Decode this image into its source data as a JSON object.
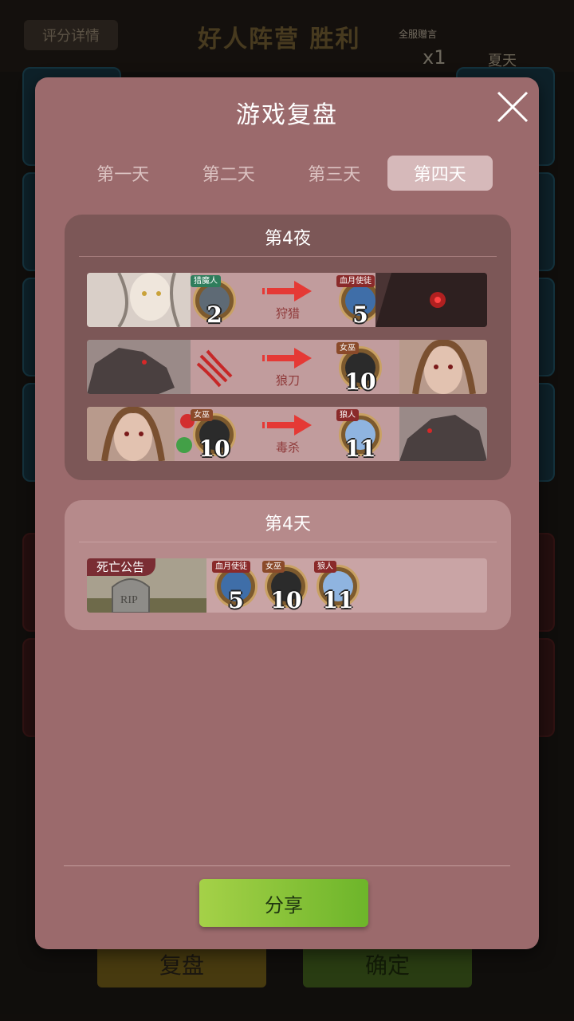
{
  "background": {
    "rating_details_label": "评分详情",
    "result_title": "好人阵营 胜利",
    "broadcast_label": "全服赠言",
    "gift_count": "x1",
    "player_name": "夏天",
    "replay_button": "复盘",
    "confirm_button": "确定"
  },
  "modal": {
    "title": "游戏复盘",
    "tabs": [
      {
        "label": "第一天",
        "active": false
      },
      {
        "label": "第二天",
        "active": false
      },
      {
        "label": "第三天",
        "active": false
      },
      {
        "label": "第四天",
        "active": true
      }
    ],
    "night": {
      "title": "第4夜",
      "events": [
        {
          "actor_role": "猎魔人",
          "actor_number": "2",
          "action": "狩猎",
          "target_role": "血月使徒",
          "target_number": "5"
        },
        {
          "actor_role": "",
          "actor_number": "",
          "action": "狼刀",
          "target_role": "女巫",
          "target_number": "10"
        },
        {
          "actor_role": "女巫",
          "actor_number": "10",
          "action": "毒杀",
          "target_role": "狼人",
          "target_number": "11"
        }
      ]
    },
    "day": {
      "title": "第4天",
      "death_label": "死亡公告",
      "deaths": [
        {
          "role": "血月使徒",
          "number": "5"
        },
        {
          "role": "女巫",
          "number": "10"
        },
        {
          "role": "狼人",
          "number": "11"
        }
      ]
    },
    "share_button": "分享"
  },
  "colors": {
    "modal_bg": "#9b6a6c",
    "tab_active_bg": "#d6b9ba",
    "share_green": "#8cc63f",
    "action_red": "#e53935"
  }
}
